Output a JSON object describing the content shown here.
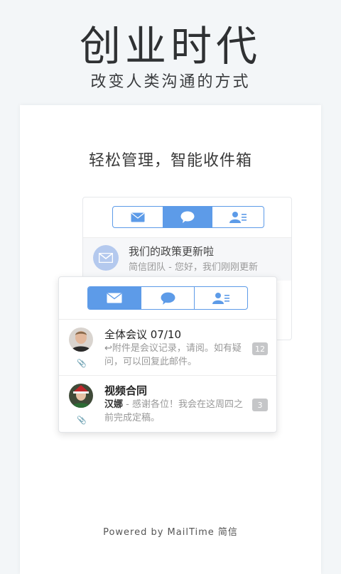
{
  "hero": {
    "title": "创业时代",
    "subtitle": "改变人类沟通的方式"
  },
  "card": {
    "heading": "轻松管理，智能收件箱",
    "footer": "Powered by MailTime 简信"
  },
  "tabs": [
    {
      "icon": "mail-icon",
      "active": true
    },
    {
      "icon": "chat-bubble-icon",
      "active": false
    },
    {
      "icon": "contacts-icon",
      "active": false
    }
  ],
  "back_panel": {
    "active_tab_index": 1,
    "message": {
      "title": "我们的政策更新啦",
      "sender": "简信团队",
      "preview": " - 您好，我们刚刚更新"
    }
  },
  "inbox": [
    {
      "title": "全体会议 07/10",
      "sender": "",
      "preview": "附件是会议记录，请阅。如有疑问，可以回复此邮件。",
      "replied": true,
      "count": "12",
      "bold": false
    },
    {
      "title": "视频合同",
      "sender": "汉娜",
      "preview": " - 感谢各位！我会在这周四之前完成定稿。",
      "replied": false,
      "count": "3",
      "bold": true
    }
  ],
  "colors": {
    "accent": "#5d9be8",
    "background": "#f3f6f8",
    "badge": "#c5c6c8"
  }
}
